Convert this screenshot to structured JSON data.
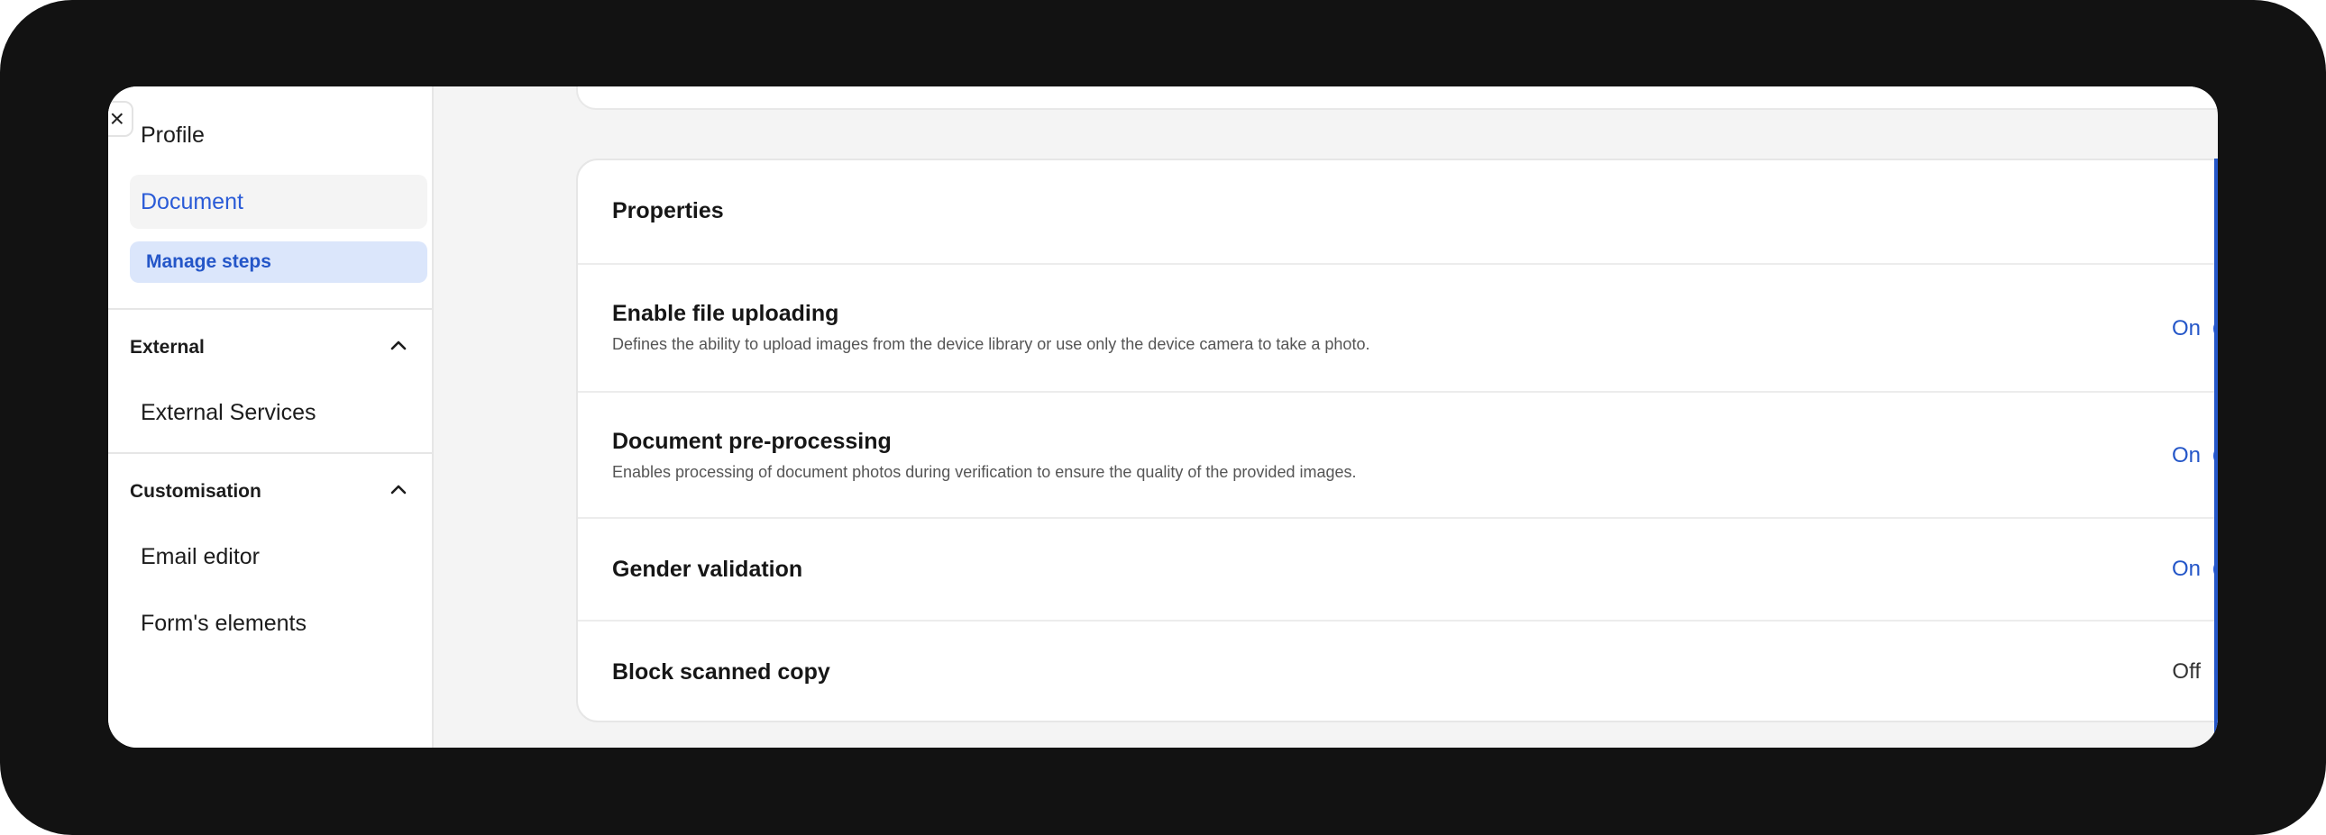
{
  "sidebar": {
    "close_glyph": "×",
    "profile": "Profile",
    "document": "Document",
    "manage_steps": "Manage steps",
    "external_section": "External",
    "external_services": "External Services",
    "customisation_section": "Customisation",
    "email_editor": "Email editor",
    "forms_elements": "Form's elements"
  },
  "properties": {
    "title": "Properties",
    "rows": [
      {
        "title": "Enable file uploading",
        "description": "Defines the ability to upload images from the device library or use only the device camera to take a photo.",
        "state_label": "On",
        "enabled": true
      },
      {
        "title": "Document pre-processing",
        "description": "Enables processing of document photos during verification to ensure the quality of the provided images.",
        "state_label": "On",
        "enabled": true
      },
      {
        "title": "Gender validation",
        "description": "",
        "state_label": "On",
        "enabled": true
      },
      {
        "title": "Block scanned copy",
        "description": "",
        "state_label": "Off",
        "enabled": false
      }
    ]
  },
  "colors": {
    "accent": "#2456c8",
    "toggle_on": "#2e5fe0",
    "frame": "#121212"
  },
  "icons": {
    "close": "close-icon",
    "chevron": "chevron-up-icon"
  }
}
